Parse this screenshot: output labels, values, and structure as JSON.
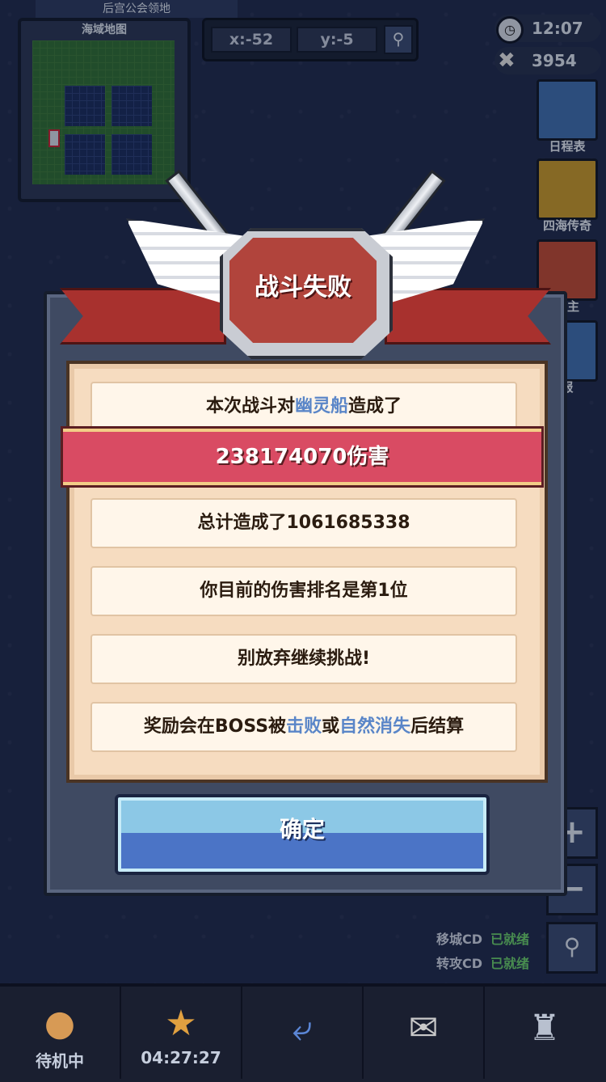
{
  "minimap": {
    "title": "海域地图",
    "top_banner": "后宫公会领地"
  },
  "coords": {
    "x": "x:-52",
    "y": "y:-5"
  },
  "status": {
    "time": "12:07",
    "gold": "3954"
  },
  "side_buttons": [
    {
      "label": "日程表",
      "color": "#3f6fb0"
    },
    {
      "label": "四海传奇",
      "color": "#c99a2a"
    },
    {
      "label": "霸主",
      "color": "#c04a34"
    },
    {
      "label": "报",
      "color": "#3f6fb0"
    }
  ],
  "dialog": {
    "title": "战斗失败",
    "line1_pre": "本次战斗对",
    "line1_target": "幽灵船",
    "line1_post": "造成了",
    "damage": "238174070伤害",
    "total": "总计造成了1061685338",
    "rank": "你目前的伤害排名是第1位",
    "encourage": "别放弃继续挑战!",
    "reward_pre": "奖励会在BOSS被",
    "reward_kill": "击败",
    "reward_or": "或",
    "reward_vanish": "自然消失",
    "reward_post": "后结算",
    "confirm": "确定"
  },
  "cooldowns": [
    {
      "label": "移城CD",
      "state": "已就绪"
    },
    {
      "label": "转攻CD",
      "state": "已就绪"
    }
  ],
  "bottom_tabs": [
    {
      "label": "待机中",
      "icon": "balloon-icon"
    },
    {
      "label": "04:27:27",
      "icon": "star-medal-icon"
    },
    {
      "label": "",
      "icon": "return-arrow-icon"
    },
    {
      "label": "",
      "icon": "mail-icon"
    },
    {
      "label": "",
      "icon": "tower-icon"
    }
  ]
}
